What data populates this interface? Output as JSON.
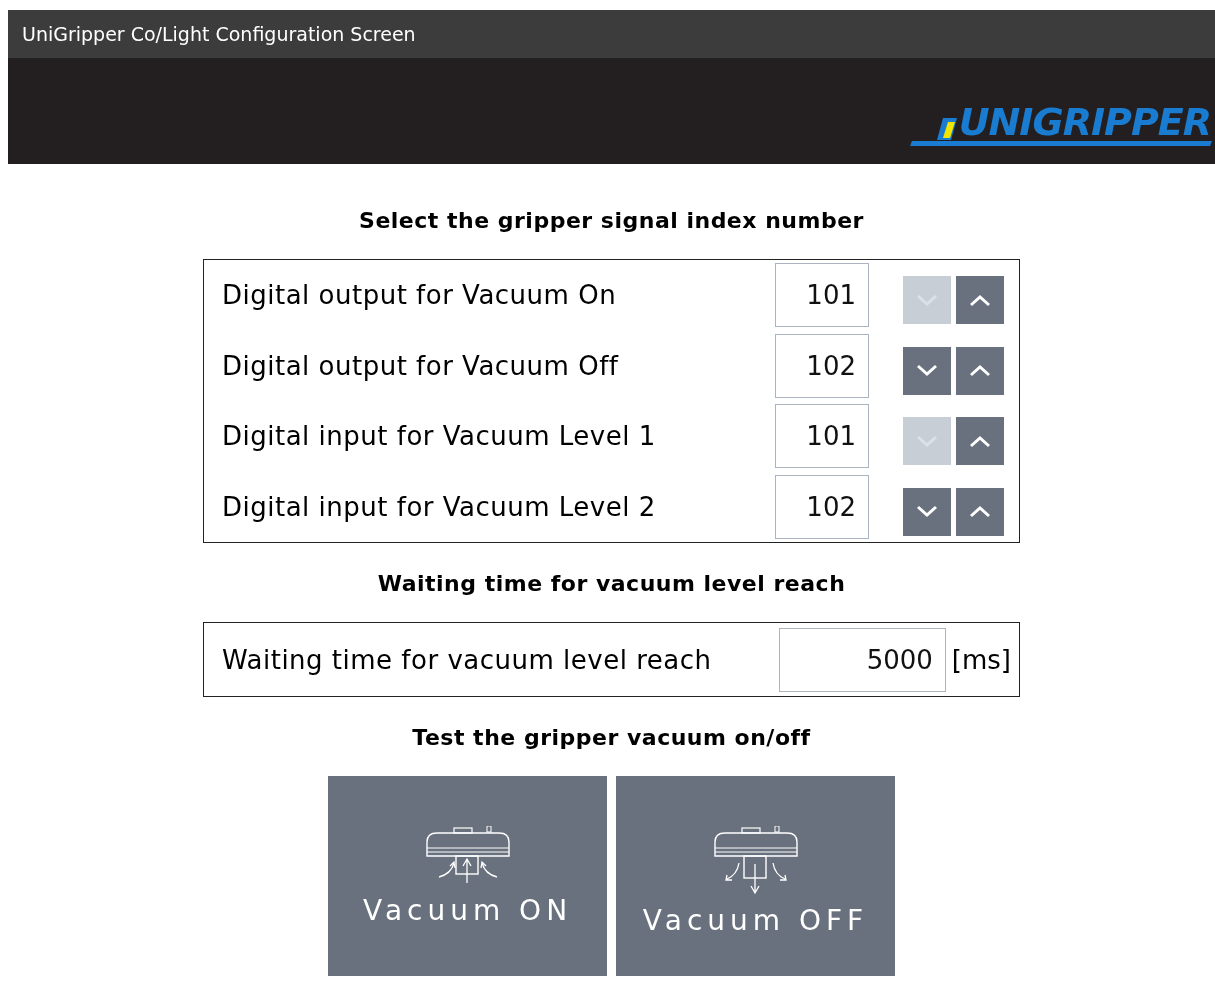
{
  "window": {
    "title": "UniGripper Co/Light Configuration Screen"
  },
  "logo": {
    "text": "UNIGRIPPER"
  },
  "signal_section": {
    "heading": "Select the gripper signal index number",
    "rows": [
      {
        "label": "Digital output for Vacuum On",
        "value": "101",
        "decrease_disabled": true
      },
      {
        "label": "Digital output for Vacuum Off",
        "value": "102",
        "decrease_disabled": false
      },
      {
        "label": "Digital input for Vacuum Level 1",
        "value": "101",
        "decrease_disabled": true
      },
      {
        "label": "Digital input for Vacuum Level 2",
        "value": "102",
        "decrease_disabled": false
      }
    ]
  },
  "waiting_section": {
    "heading": "Waiting time for vacuum level reach",
    "label": "Waiting time for vacuum level reach",
    "value": "5000",
    "unit": "[ms]"
  },
  "test_section": {
    "heading": "Test the gripper vacuum on/off",
    "buttons": [
      {
        "kind": "on",
        "label": "Vacuum ON"
      },
      {
        "kind": "off",
        "label": "Vacuum OFF"
      }
    ]
  }
}
